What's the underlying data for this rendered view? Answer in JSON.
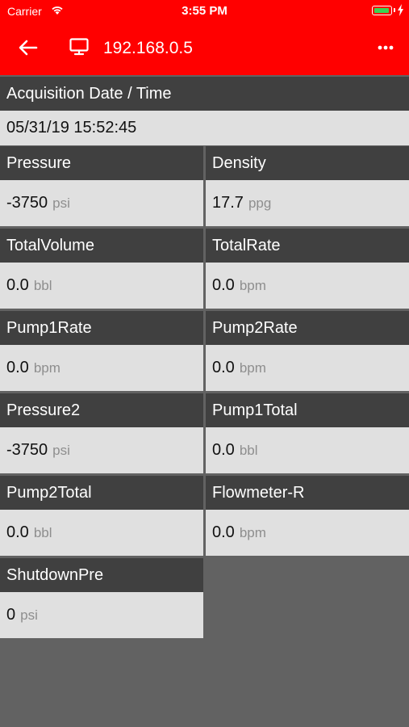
{
  "status_bar": {
    "carrier": "Carrier",
    "time": "3:55 PM",
    "battery_color": "#39d353"
  },
  "header": {
    "title": "192.168.0.5",
    "back_icon": "arrow-left-icon",
    "device_icon": "monitor-icon",
    "menu_icon": "more-horizontal-icon",
    "background": "#ff0000"
  },
  "acquisition": {
    "label": "Acquisition Date / Time",
    "value": "05/31/19  15:52:45"
  },
  "readings": [
    {
      "label": "Pressure",
      "value": "-3750",
      "unit": "psi"
    },
    {
      "label": "Density",
      "value": "17.7",
      "unit": "ppg"
    },
    {
      "label": "TotalVolume",
      "value": "0.0",
      "unit": "bbl"
    },
    {
      "label": "TotalRate",
      "value": "0.0",
      "unit": "bpm"
    },
    {
      "label": "Pump1Rate",
      "value": "0.0",
      "unit": "bpm"
    },
    {
      "label": "Pump2Rate",
      "value": "0.0",
      "unit": "bpm"
    },
    {
      "label": "Pressure2",
      "value": "-3750",
      "unit": "psi"
    },
    {
      "label": "Pump1Total",
      "value": "0.0",
      "unit": "bbl"
    },
    {
      "label": "Pump2Total",
      "value": "0.0",
      "unit": "bbl"
    },
    {
      "label": "Flowmeter-R",
      "value": "0.0",
      "unit": "bpm"
    },
    {
      "label": "ShutdownPre",
      "value": "0",
      "unit": "psi"
    }
  ]
}
